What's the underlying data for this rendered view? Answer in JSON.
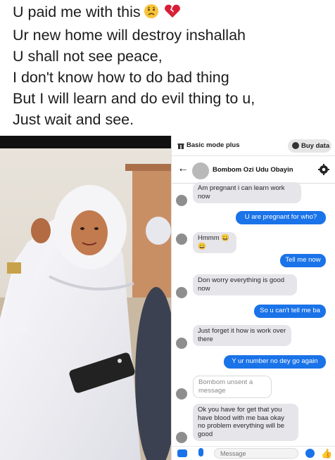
{
  "caption": {
    "lines": [
      "U paid me with this",
      "Ur new home will destroy inshallah",
      "U shall not see peace,",
      "I don't know how to do bad thing",
      "But I will learn and do evil thing to u,",
      "Just wait and see."
    ],
    "line1_emojis": [
      "worried-face",
      "broken-heart"
    ]
  },
  "photo": {
    "description_icon": "woman-in-white-hijab-photo"
  },
  "chat": {
    "mode_label": "Basic mode plus",
    "buy_data_label": "Buy data",
    "contact_name": "Bombom Ozi Udu Obayin",
    "composer_placeholder": "Message",
    "accent_color": "#1a73e8",
    "messages": [
      {
        "dir": "in",
        "text": "Am pregnant i can learn work now"
      },
      {
        "dir": "out",
        "text": "U are pregnant for who?"
      },
      {
        "dir": "in",
        "text": "Hmmm 😀😀"
      },
      {
        "dir": "out",
        "text": "Tell me now"
      },
      {
        "dir": "in",
        "text": "Don worry everything is good now"
      },
      {
        "dir": "out",
        "text": "So u can't tell me ba"
      },
      {
        "dir": "in",
        "text": "Just forget it how is work over there"
      },
      {
        "dir": "out",
        "text": "Y ur number no dey go again"
      },
      {
        "dir": "unsent",
        "text": "Bombom unsent a message"
      },
      {
        "dir": "in",
        "text": "Ok you have for get that you have blood with me baa okay no problem everything will be good"
      }
    ]
  }
}
